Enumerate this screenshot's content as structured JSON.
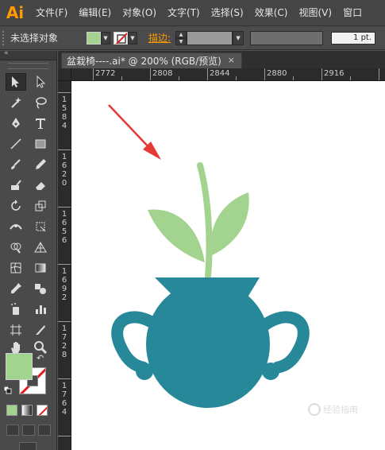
{
  "app": {
    "logo": "Ai",
    "menu": [
      "文件(F)",
      "编辑(E)",
      "对象(O)",
      "文字(T)",
      "选择(S)",
      "效果(C)",
      "视图(V)",
      "窗口"
    ]
  },
  "control_bar": {
    "selection_status": "未选择对象",
    "stroke_label": "描边:",
    "stroke_weight": "1 pt."
  },
  "tools_panel": {
    "collapse_label": "«"
  },
  "document": {
    "tab_title": "盆栽椅----.ai* @ 200% (RGB/预览)",
    "close_glyph": "×"
  },
  "rulers": {
    "top_labels": [
      "2772",
      "2808",
      "2844",
      "2880",
      "2916"
    ],
    "left_labels": [
      "1584",
      "1620",
      "1656",
      "1692",
      "1728",
      "1764"
    ]
  },
  "colors": {
    "fill": "#a3d48f",
    "stroke": "none",
    "vase": "#268899",
    "leaves": "#a3d48f",
    "arrow": "#e53935",
    "logo": "#ff9a00"
  },
  "watermark": "经验指南"
}
